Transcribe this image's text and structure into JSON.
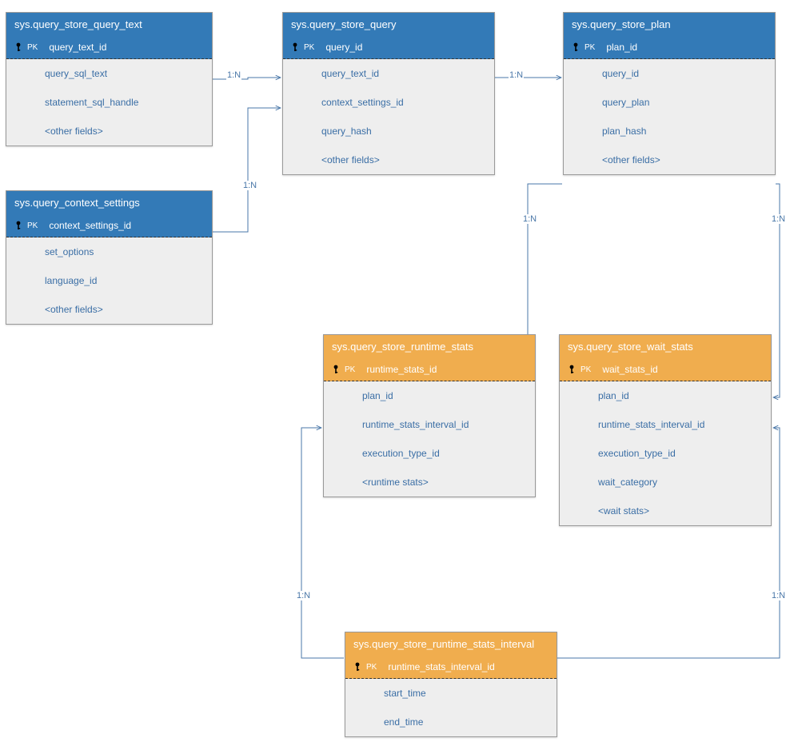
{
  "entities": {
    "query_text": {
      "title": "sys.query_store_query_text",
      "pk": "query_text_id",
      "fields": [
        "query_sql_text",
        "statement_sql_handle",
        "<other fields>"
      ]
    },
    "query": {
      "title": "sys.query_store_query",
      "pk": "query_id",
      "fields": [
        "query_text_id",
        "context_settings_id",
        "query_hash",
        "<other fields>"
      ]
    },
    "plan": {
      "title": "sys.query_store_plan",
      "pk": "plan_id",
      "fields": [
        "query_id",
        "query_plan",
        "plan_hash",
        "<other fields>"
      ]
    },
    "context": {
      "title": "sys.query_context_settings",
      "pk": "context_settings_id",
      "fields": [
        "set_options",
        "language_id",
        "<other fields>"
      ]
    },
    "runtime": {
      "title": "sys.query_store_runtime_stats",
      "pk": "runtime_stats_id",
      "fields": [
        "plan_id",
        "runtime_stats_interval_id",
        "execution_type_id",
        "<runtime stats>"
      ]
    },
    "wait": {
      "title": "sys.query_store_wait_stats",
      "pk": "wait_stats_id",
      "fields": [
        "plan_id",
        "runtime_stats_interval_id",
        "execution_type_id",
        "wait_category",
        "<wait stats>"
      ]
    },
    "interval": {
      "title": "sys.query_store_runtime_stats_interval",
      "pk": "runtime_stats_interval_id",
      "fields": [
        "start_time",
        "end_time"
      ]
    }
  },
  "labels": {
    "pk": "PK",
    "one_to_n": "1:N"
  },
  "colors": {
    "blue": "#337ab7",
    "yellow": "#f0ad4e",
    "link_color": "#4a77a8"
  }
}
